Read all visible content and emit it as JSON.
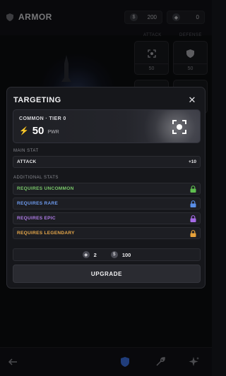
{
  "header": {
    "title": "ARMOR",
    "coins_value": "200",
    "gems_value": "0"
  },
  "grid": {
    "columns": [
      "ATTACK",
      "DEFENSE"
    ],
    "tiles": [
      {
        "icon": "crosshair-icon",
        "value": "50"
      },
      {
        "icon": "shield-icon",
        "value": "50"
      }
    ]
  },
  "modal": {
    "title": "TARGETING",
    "item": {
      "rarity_tier": "COMMON · TIER 0",
      "power_value": "50",
      "power_unit": "PWR",
      "icon": "targeting-icon"
    },
    "main_stat_label": "MAIN STAT",
    "main_stat": {
      "name": "ATTACK",
      "value": "+10"
    },
    "additional_stats_label": "ADDITIONAL STATS",
    "additional_stats": [
      {
        "label": "REQUIRES UNCOMMON",
        "color": "#79c96a",
        "lock_color": "#5fbf4f"
      },
      {
        "label": "REQUIRES RARE",
        "color": "#6f9cf0",
        "lock_color": "#5a8fe8"
      },
      {
        "label": "REQUIRES EPIC",
        "color": "#b07ce8",
        "lock_color": "#a56ae6"
      },
      {
        "label": "REQUIRES LEGENDARY",
        "color": "#e9a94a",
        "lock_color": "#e8a23a"
      }
    ],
    "cost": {
      "gems": "2",
      "coins": "100"
    },
    "upgrade_label": "UPGRADE"
  },
  "nav": {
    "items": [
      "back-arrow-icon",
      "shield-icon",
      "wrench-icon",
      "sparkle-icon"
    ],
    "active_color": "#3b6fe0"
  }
}
